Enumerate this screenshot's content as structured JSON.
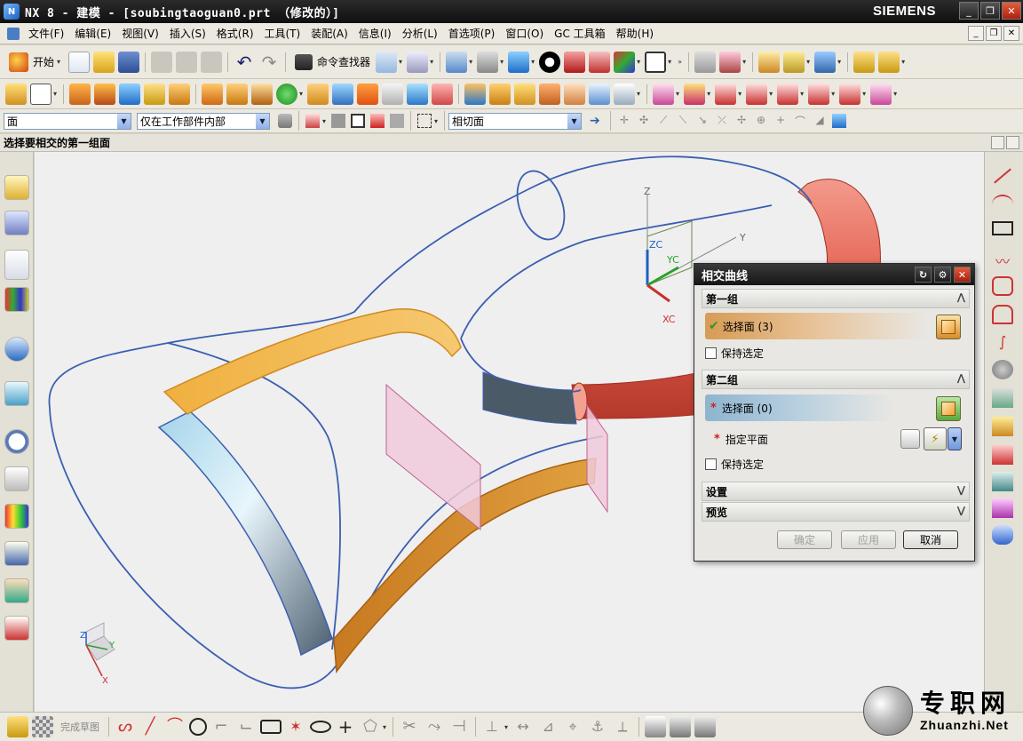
{
  "window": {
    "title": "NX 8 - 建模 - [soubingtaoguan0.prt （修改的）]",
    "brand": "SIEMENS"
  },
  "menu": {
    "items": [
      "文件(F)",
      "编辑(E)",
      "视图(V)",
      "插入(S)",
      "格式(R)",
      "工具(T)",
      "装配(A)",
      "信息(I)",
      "分析(L)",
      "首选项(P)",
      "窗口(O)",
      "GC 工具箱",
      "帮助(H)"
    ]
  },
  "toolbar": {
    "start_label": "开始",
    "command_finder_label": "命令查找器"
  },
  "selection_bar": {
    "filter_value": "面",
    "scope_value": "仅在工作部件内部",
    "face_rule_value": "相切面"
  },
  "cue_line": {
    "text": "选择要相交的第一组面"
  },
  "sketch_bar": {
    "finish_sketch_label": "完成草图"
  },
  "viewport": {
    "wcs_labels": {
      "z": "Z",
      "zc": "ZC",
      "yc": "YC",
      "y": "Y",
      "xc": "XC"
    },
    "triad_labels": {
      "z": "Z",
      "y": "Y",
      "x": "X"
    },
    "colors": {
      "background": "#efeff0",
      "curve": "#3b5fb0",
      "orange_face": "#e8a23a",
      "blue_face": "#9fd0e4",
      "red_tube": "#e46a5c",
      "pink_plane": "#f0cadb"
    }
  },
  "dialog": {
    "title": "相交曲线",
    "group1": {
      "header": "第一组",
      "select_label": "选择面 (3)",
      "keep_label": "保持选定"
    },
    "group2": {
      "header": "第二组",
      "select_label": "选择面 (0)",
      "plane_label": "指定平面",
      "keep_label": "保持选定"
    },
    "settings_header": "设置",
    "preview_header": "预览",
    "buttons": {
      "ok": "确定",
      "apply": "应用",
      "cancel": "取消"
    }
  },
  "watermark": {
    "cn": "专职网",
    "url": "Zhuanzhi.Net"
  }
}
